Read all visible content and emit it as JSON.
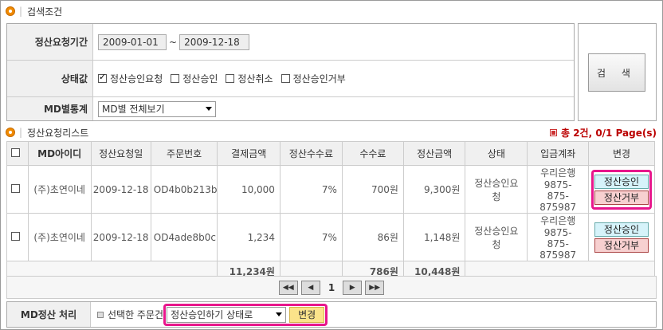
{
  "search": {
    "title": "검색조건",
    "period_label": "정산요청기간",
    "date_from": "2009-01-01",
    "date_sep": "~",
    "date_to": "2009-12-18",
    "status_label": "상태값",
    "status_options": [
      {
        "label": "정산승인요청",
        "checked": true
      },
      {
        "label": "정산승인",
        "checked": false
      },
      {
        "label": "정산취소",
        "checked": false
      },
      {
        "label": "정산승인거부",
        "checked": false
      }
    ],
    "md_label": "MD별통계",
    "md_select": "MD별 전체보기",
    "button": "검 색"
  },
  "list": {
    "title": "정산요청리스트",
    "total": "총 2건, 0/1 Page(s)",
    "headers": [
      "",
      "MD아이디",
      "정산요청일",
      "주문번호",
      "결제금액",
      "정산수수료",
      "수수료",
      "정산금액",
      "상태",
      "입금계좌",
      "변경"
    ],
    "rows": [
      {
        "md": "(주)초연이네",
        "date": "2009-12-18",
        "order": "OD4b0b213b",
        "pay": "10,000",
        "rate": "7%",
        "fee": "700원",
        "settle": "9,300원",
        "status": "정산승인요청",
        "bank": "우리은행",
        "account": "9875-875-875987",
        "approve": "정산승인",
        "reject": "정산거부"
      },
      {
        "md": "(주)초연이네",
        "date": "2009-12-18",
        "order": "OD4ade8b0c",
        "pay": "1,234",
        "rate": "7%",
        "fee": "86원",
        "settle": "1,148원",
        "status": "정산승인요청",
        "bank": "우리은행",
        "account": "9875-875-875987",
        "approve": "정산승인",
        "reject": "정산거부"
      }
    ],
    "sum": {
      "pay": "11,234원",
      "fee": "786원",
      "settle": "10,448원"
    }
  },
  "pager": {
    "current": "1"
  },
  "bulk": {
    "label": "MD정산 처리",
    "prefix": "선택한 주문건",
    "select": "정산승인하기 상태로",
    "button": "변경"
  },
  "colors": {
    "accent": "#e8168c",
    "total": "#bb0000",
    "link": "#1b2c8f"
  }
}
